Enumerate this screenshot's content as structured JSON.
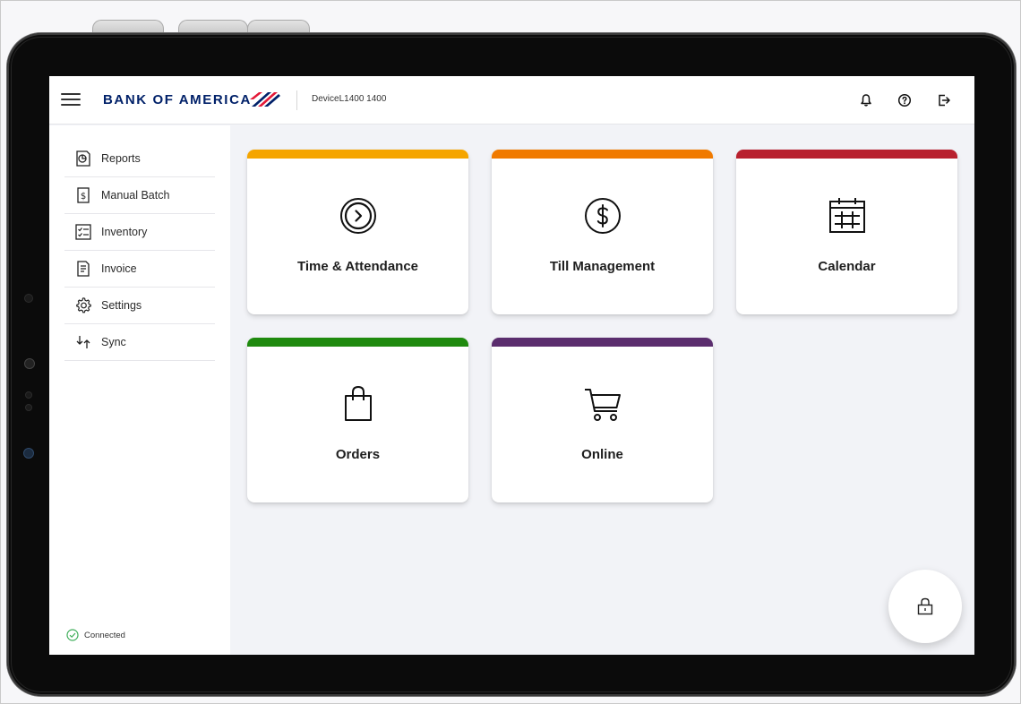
{
  "header": {
    "brand": "BANK OF AMERICA",
    "device_label": "DeviceL1400 1400",
    "icons": [
      "menu-icon",
      "bell-icon",
      "help-icon",
      "logout-icon"
    ]
  },
  "sidebar": {
    "items": [
      {
        "label": "Reports",
        "icon": "reports-icon"
      },
      {
        "label": "Manual Batch",
        "icon": "dollar-document-icon"
      },
      {
        "label": "Inventory",
        "icon": "checklist-icon"
      },
      {
        "label": "Invoice",
        "icon": "invoice-icon"
      },
      {
        "label": "Settings",
        "icon": "gear-icon"
      },
      {
        "label": "Sync",
        "icon": "sync-icon"
      }
    ],
    "status": {
      "label": "Connected",
      "color": "#3fae5a"
    }
  },
  "tiles": [
    {
      "label": "Time & Attendance",
      "color": "#f5a500",
      "icon": "clock-arrow-icon"
    },
    {
      "label": "Till Management",
      "color": "#f07a00",
      "icon": "dollar-circle-icon"
    },
    {
      "label": "Calendar",
      "color": "#b8202e",
      "icon": "calendar-icon"
    },
    {
      "label": "Orders",
      "color": "#1f8a0e",
      "icon": "shopping-bag-icon"
    },
    {
      "label": "Online",
      "color": "#5b2d6e",
      "icon": "cart-icon"
    }
  ],
  "fab": {
    "icon": "lock-icon"
  },
  "colors": {
    "brand_navy": "#012169",
    "brand_red": "#e31837"
  }
}
